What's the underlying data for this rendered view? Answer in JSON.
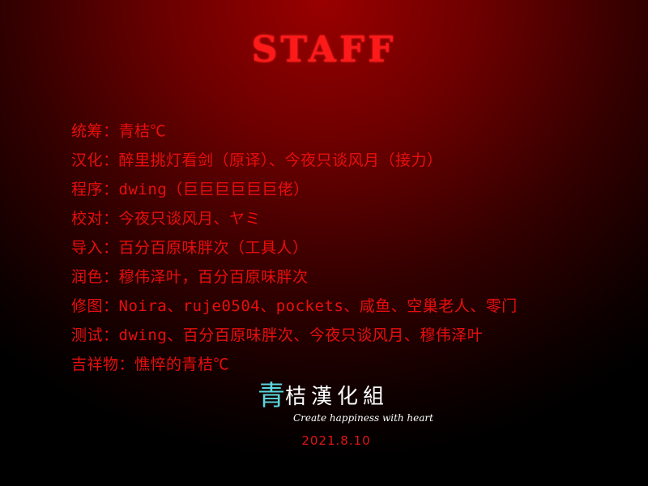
{
  "title": "STAFF",
  "credits": [
    "统筹：青桔℃",
    "汉化：醉里挑灯看剑（原译）、今夜只谈风月（接力）",
    "程序：dwing（巨巨巨巨巨巨佬）",
    "校对：今夜只谈风月、ヤミ",
    "导入：百分百原味胖次（工具人）",
    "润色：穆伟泽叶，百分百原味胖次",
    "修图：Noira、ruje0504、pockets、咸鱼、空巢老人、零门",
    "测试：dwing、百分百原味胖次、今夜只谈风月、穆伟泽叶",
    "吉祥物：憔悴的青桔℃"
  ],
  "logo": {
    "first_char": "青",
    "rest": "桔漢化組",
    "slogan": "Create happiness with heart"
  },
  "date": "2021.8.10",
  "colors": {
    "text_red": "#e80e0e",
    "title_red": "#ff1a1a",
    "logo_cyan": "#5bd6dc",
    "logo_white": "#ffffff",
    "background_top": "#9a0000",
    "background_edge": "#000000"
  }
}
